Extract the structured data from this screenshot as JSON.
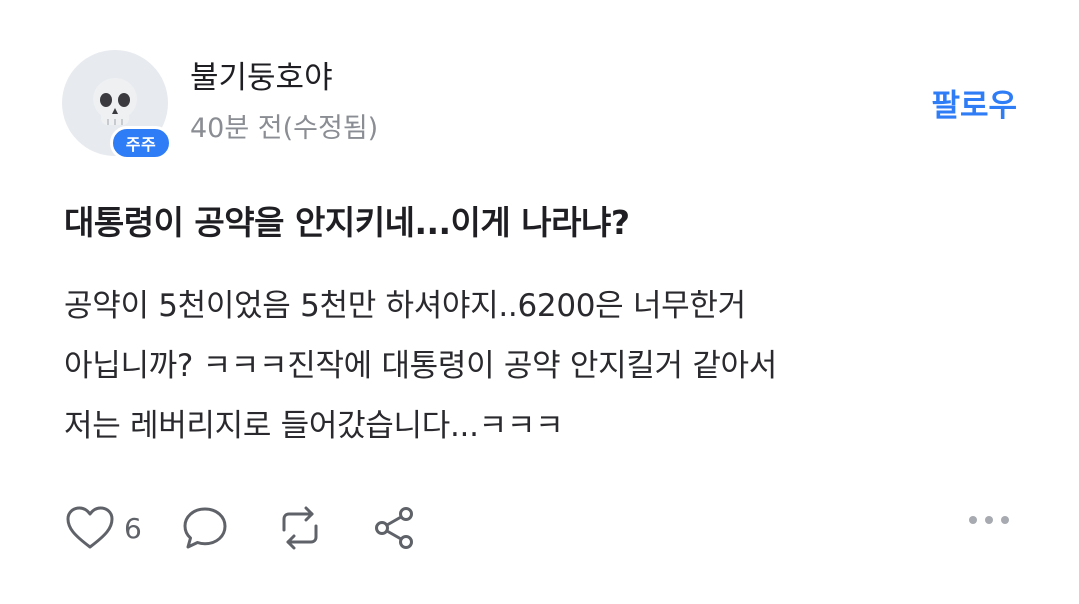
{
  "author": {
    "name": "불기둥호야",
    "badge": "주주",
    "timestamp": "40분 전(수정됨)",
    "avatar_icon": "skull-emoji-icon"
  },
  "follow_label": "팔로우",
  "post": {
    "title": "대통령이 공약을 안지키네...이게 나라냐?",
    "body_lines": [
      "공약이 5천이었음 5천만 하셔야지..6200은 너무한거",
      "아닙니까? ㅋㅋㅋ진작에 대통령이 공약 안지킬거 같아서",
      "저는 레버리지로 들어갔습니다...ㅋㅋㅋ"
    ]
  },
  "actions": {
    "like_icon": "heart-icon",
    "like_count": "6",
    "comment_icon": "comment-icon",
    "repost_icon": "repost-icon",
    "share_icon": "share-icon",
    "more_icon": "more-horizontal-icon"
  },
  "colors": {
    "accent": "#2f7df6",
    "muted": "#8a8d93",
    "icon": "#5f6268"
  }
}
